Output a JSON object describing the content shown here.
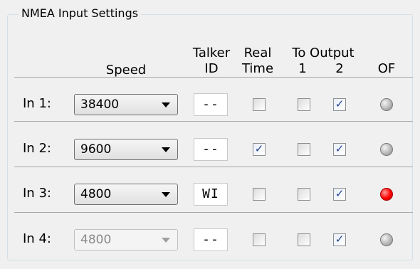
{
  "group": {
    "title": "NMEA Input Settings"
  },
  "headers": {
    "speed": "Speed",
    "talker_id_line1": "Talker",
    "talker_id_line2": "ID",
    "real_time_line1": "Real",
    "real_time_line2": "Time",
    "to_output": "To Output",
    "output_1": "1",
    "output_2": "2",
    "of": "OF"
  },
  "rows": [
    {
      "label": "In 1:",
      "speed": "38400",
      "talker_id": "--",
      "real_time": false,
      "out1": false,
      "out2": true,
      "of_led": "off",
      "enabled": true
    },
    {
      "label": "In 2:",
      "speed": "9600",
      "talker_id": "--",
      "real_time": true,
      "out1": false,
      "out2": true,
      "of_led": "off",
      "enabled": true
    },
    {
      "label": "In 3:",
      "speed": "4800",
      "talker_id": "WI",
      "real_time": false,
      "out1": false,
      "out2": true,
      "of_led": "on",
      "enabled": true
    },
    {
      "label": "In 4:",
      "speed": "4800",
      "talker_id": "--",
      "real_time": false,
      "out1": false,
      "out2": true,
      "of_led": "off",
      "enabled": false
    }
  ],
  "colors": {
    "led_on": "#ff0000",
    "led_off": "#a8a8a8",
    "checkmark": "#21438e"
  },
  "icons": {
    "combo_arrow": "chevron-down-icon",
    "checkmark": "checkmark-icon",
    "led": "status-led-icon"
  }
}
